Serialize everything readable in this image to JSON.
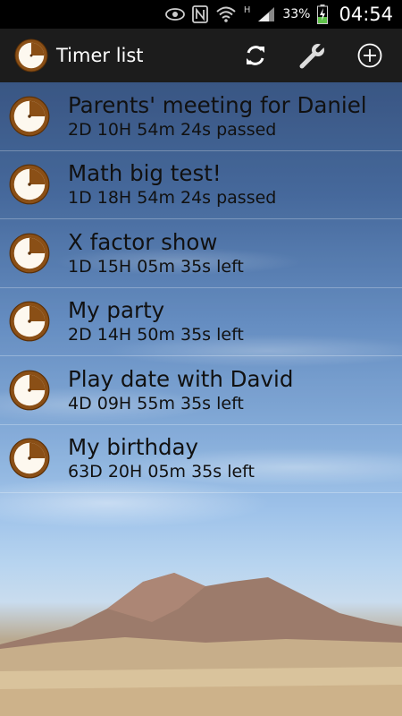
{
  "status_bar": {
    "battery_percent": "33%",
    "time": "04:54",
    "network_label": "H"
  },
  "action_bar": {
    "title": "Timer list",
    "icons": [
      "clock-icon",
      "refresh-icon",
      "settings-wrench-icon",
      "add-icon"
    ]
  },
  "timers": [
    {
      "title": "Parents' meeting for Daniel",
      "status": "2D 10H 54m 24s passed"
    },
    {
      "title": "Math big test!",
      "status": "1D 18H 54m 24s passed"
    },
    {
      "title": "X factor show",
      "status": "1D 15H 05m 35s left"
    },
    {
      "title": "My party",
      "status": "2D 14H 50m 35s left"
    },
    {
      "title": "Play date with David",
      "status": "4D 09H 55m 35s left"
    },
    {
      "title": "My birthday",
      "status": "63D 20H 05m 35s left"
    }
  ],
  "colors": {
    "clock_brown": "#8a4f16",
    "clock_face": "#fdf8ef",
    "action_bar": "#1c1c1c"
  }
}
